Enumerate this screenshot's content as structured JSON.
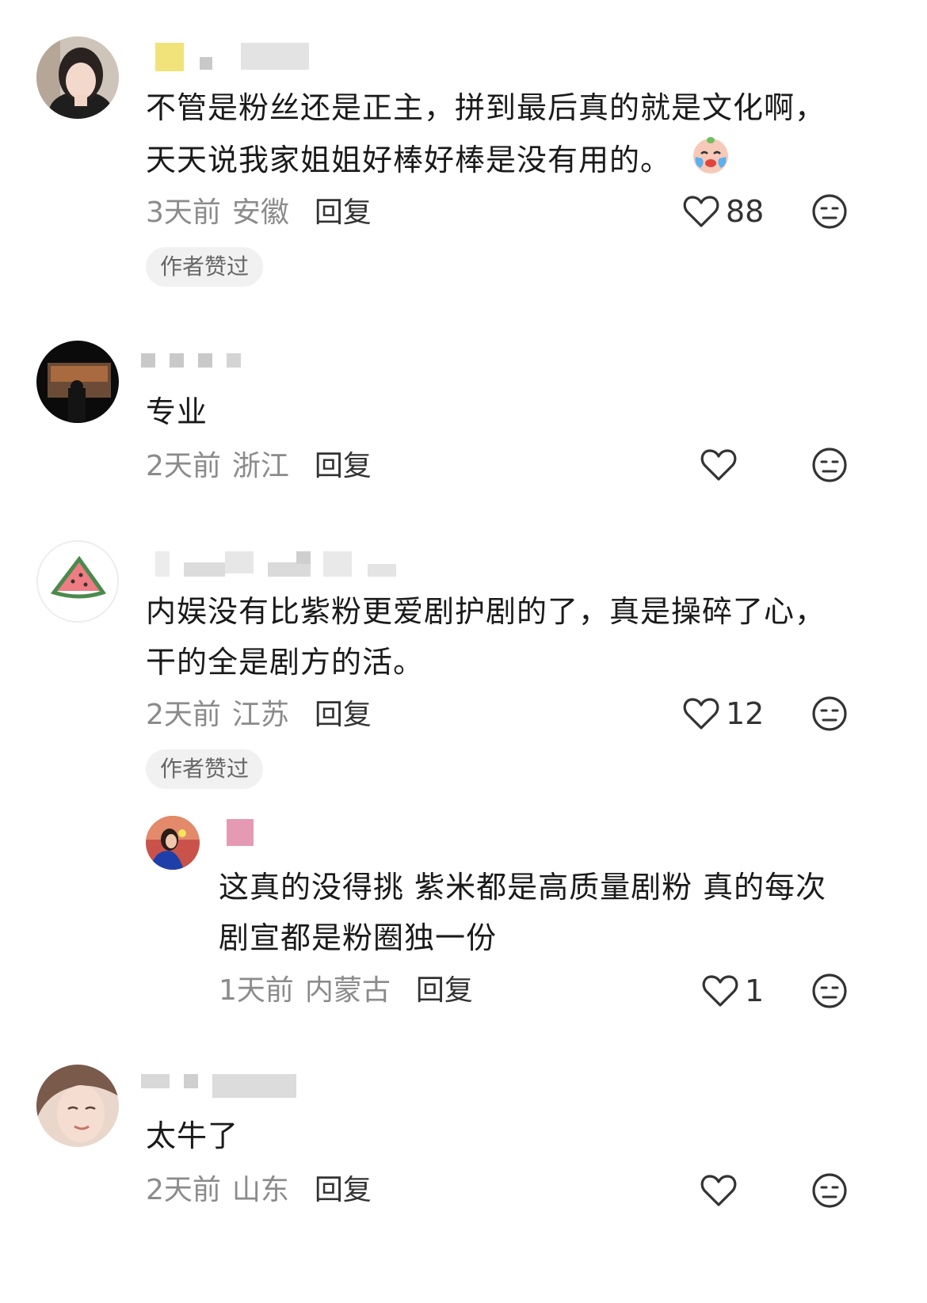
{
  "comments": [
    {
      "text_lines": [
        "不管是粉丝还是正主，拼到最后真的就是文化啊，",
        "天天说我家姐姐好棒好棒是没有用的。"
      ],
      "emoji": "crying-face-emoji",
      "time": "3天前",
      "location": "安徽",
      "reply_label": "回复",
      "likes": "88",
      "badge": "作者赞过"
    },
    {
      "text_lines": [
        "专业"
      ],
      "time": "2天前",
      "location": "浙江",
      "reply_label": "回复",
      "likes": ""
    },
    {
      "text_lines": [
        "内娱没有比紫粉更爱剧护剧的了，真是操碎了心，",
        "干的全是剧方的活。"
      ],
      "time": "2天前",
      "location": "江苏",
      "reply_label": "回复",
      "likes": "12",
      "badge": "作者赞过",
      "reply": {
        "text_lines": [
          "这真的没得挑 紫米都是高质量剧粉 真的每次",
          "剧宣都是粉圈独一份"
        ],
        "time": "1天前",
        "location": "内蒙古",
        "reply_label": "回复",
        "likes": "1"
      }
    },
    {
      "text_lines": [
        "太牛了"
      ],
      "time": "2天前",
      "location": "山东",
      "reply_label": "回复",
      "likes": ""
    }
  ],
  "icons": {
    "like": "heart-outline-icon",
    "dislike": "meh-face-icon"
  },
  "colors": {
    "meta_gray": "#8b8b8b",
    "badge_bg": "#f1f1f1"
  }
}
